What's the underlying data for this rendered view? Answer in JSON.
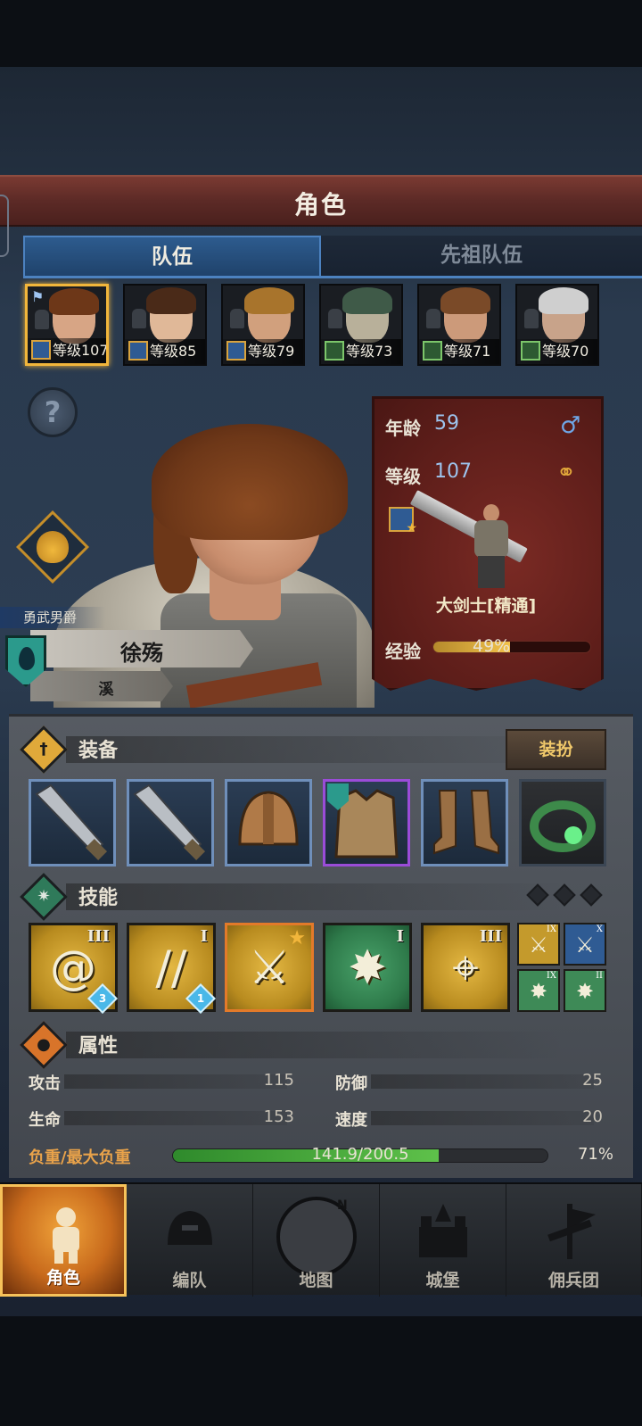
{
  "header": {
    "title": "角色"
  },
  "tabs": [
    {
      "label": "队伍",
      "active": true
    },
    {
      "label": "先祖队伍",
      "active": false
    }
  ],
  "party": [
    {
      "level_text": "等级107",
      "class_color": "#2f5b93",
      "selected": true,
      "hair": "#6d3718",
      "face": "#d7a585"
    },
    {
      "level_text": "等级85",
      "class_color": "#2f5b93",
      "selected": false,
      "hair": "#4a2a18",
      "face": "#e0b898"
    },
    {
      "level_text": "等级79",
      "class_color": "#2f5b93",
      "selected": false,
      "hair": "#a8742c",
      "face": "#d1a07d"
    },
    {
      "level_text": "等级73",
      "class_color": "#2d5a32",
      "selected": false,
      "hair": "#3f5a48",
      "face": "#b8b09a"
    },
    {
      "level_text": "等级71",
      "class_color": "#2d5a32",
      "selected": false,
      "hair": "#7a4a28",
      "face": "#cc9a7a"
    },
    {
      "level_text": "等级70",
      "class_color": "#2d5a32",
      "selected": false,
      "hair": "#cfcfcf",
      "face": "#c8a38a"
    }
  ],
  "character": {
    "title": "勇武男爵",
    "name": "徐殇",
    "sub_name": "溪",
    "age_label": "年龄",
    "age": "59",
    "level_label": "等级",
    "level": "107",
    "class_name": "大剑士[精通]",
    "exp_label": "经验",
    "exp_percent_text": "49%",
    "exp_fraction": 0.49
  },
  "equipment": {
    "section_label": "装备",
    "dress_button": "装扮",
    "items": [
      {
        "name": "greatsword-icon",
        "rarity": "rare"
      },
      {
        "name": "greatsword-icon",
        "rarity": "rare"
      },
      {
        "name": "helmet-icon",
        "rarity": "rare"
      },
      {
        "name": "armor-icon",
        "rarity": "epic"
      },
      {
        "name": "boots-icon",
        "rarity": "rare"
      },
      {
        "name": "ring-icon",
        "rarity": "common"
      }
    ]
  },
  "skills": {
    "section_label": "技能",
    "items": [
      {
        "name": "whirlwind-skill-icon",
        "color": "gold",
        "rank": "III",
        "gem": "3"
      },
      {
        "name": "twin-blades-skill-icon",
        "color": "gold",
        "rank": "I",
        "gem": "1"
      },
      {
        "name": "sword-guard-skill-icon",
        "color": "gold",
        "rank": "",
        "gem": "",
        "selected": true
      },
      {
        "name": "crystal-burst-skill-icon",
        "color": "green",
        "rank": "I",
        "gem": ""
      },
      {
        "name": "target-strike-skill-icon",
        "color": "gold",
        "rank": "III",
        "gem": ""
      }
    ],
    "mini": [
      {
        "color": "gold",
        "rank": "IX"
      },
      {
        "color": "blue",
        "rank": "X"
      },
      {
        "color": "green",
        "rank": "IX"
      },
      {
        "color": "green",
        "rank": "II"
      }
    ]
  },
  "attributes": {
    "section_label": "属性",
    "attack_label": "攻击",
    "attack": "115",
    "defense_label": "防御",
    "defense": "25",
    "health_label": "生命",
    "health": "153",
    "speed_label": "速度",
    "speed": "20",
    "load_label": "负重/最大负重",
    "load_text": "141.9/200.5",
    "load_percent_text": "71%",
    "load_fraction": 0.71
  },
  "nav": [
    {
      "label": "角色",
      "active": true
    },
    {
      "label": "编队",
      "active": false
    },
    {
      "label": "地图",
      "active": false
    },
    {
      "label": "城堡",
      "active": false
    },
    {
      "label": "佣兵团",
      "active": false
    }
  ],
  "compass_letter": "N",
  "gender_symbol": "♂",
  "help_symbol": "?"
}
